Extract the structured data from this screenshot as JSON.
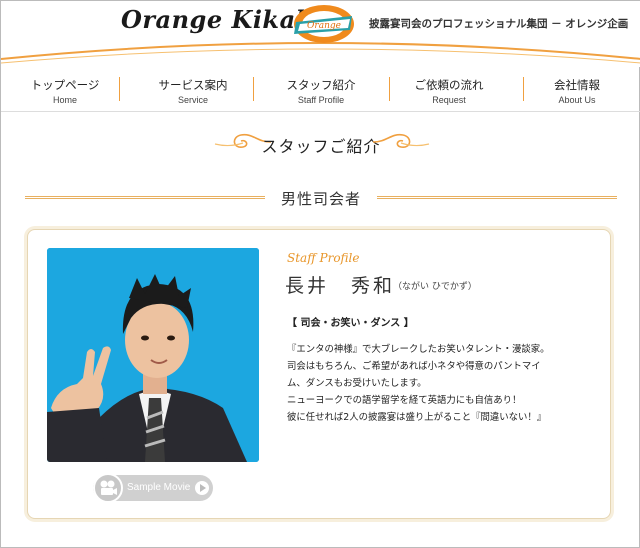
{
  "header": {
    "brand": "Orange Kikaku",
    "logo_text": "Orange",
    "tagline": "披露宴司会のプロフェッショナル集団 － オレンジ企画"
  },
  "nav": [
    {
      "jp": "トップページ",
      "en": "Home"
    },
    {
      "jp": "サービス案内",
      "en": "Service"
    },
    {
      "jp": "スタッフ紹介",
      "en": "Staff Profile"
    },
    {
      "jp": "ご依頼の流れ",
      "en": "Request"
    },
    {
      "jp": "会社情報",
      "en": "About Us"
    }
  ],
  "page_title": "スタッフご紹介",
  "section_title": "男性司会者",
  "profile": {
    "label": "Staff Profile",
    "name": "長井　秀和",
    "reading": "（ながい ひでかず）",
    "specialty": "【 司会・お笑い・ダンス 】",
    "bio": [
      "『エンタの神様』で大ブレークしたお笑いタレント・漫談家。",
      "司会はもちろん、ご希望があれば小ネタや得意のパントマイ",
      "ム、ダンスもお受けいたします。",
      "ニューヨークでの語学留学を経て英語力にも自信あり！",
      "彼に任せれば2人の披露宴は盛り上がること『間違いない！』"
    ],
    "movie_button": "Sample Movie"
  },
  "colors": {
    "accent": "#f0a040",
    "photo_bg": "#1aa6df",
    "profile_label": "#e8962a"
  }
}
